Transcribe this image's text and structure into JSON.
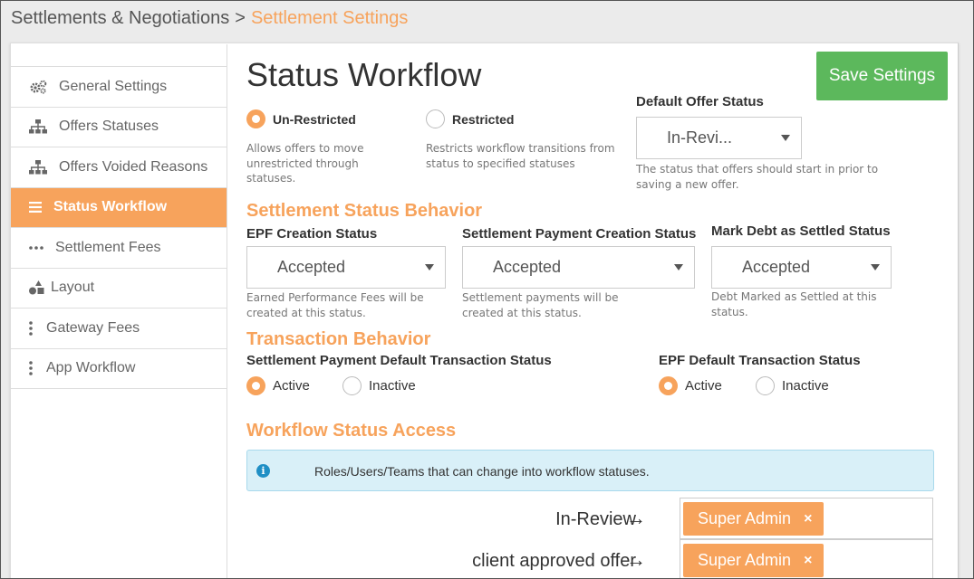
{
  "breadcrumb": {
    "parent": "Settlements & Negotiations",
    "separator": ">",
    "current": "Settlement Settings"
  },
  "sidebar": {
    "items": [
      {
        "label": "General Settings",
        "icon": "gears-icon",
        "active": false
      },
      {
        "label": "Offers Statuses",
        "icon": "sitemap-icon",
        "active": false
      },
      {
        "label": "Offers Voided Reasons",
        "icon": "sitemap-icon",
        "active": false
      },
      {
        "label": "Status Workflow",
        "icon": "list-icon",
        "active": true
      },
      {
        "label": "Settlement Fees",
        "icon": "ellipsis-h-icon",
        "active": false
      },
      {
        "label": "Layout",
        "icon": "shapes-icon",
        "active": false
      },
      {
        "label": "Gateway Fees",
        "icon": "ellipsis-v-icon",
        "active": false
      },
      {
        "label": "App Workflow",
        "icon": "ellipsis-v-icon",
        "active": false
      }
    ]
  },
  "main": {
    "title": "Status Workflow",
    "save_label": "Save Settings",
    "mode": {
      "unrestricted": {
        "label": "Un-Restricted",
        "help": "Allows offers to move unrestricted through statuses.",
        "selected": true
      },
      "restricted": {
        "label": "Restricted",
        "help": "Restricts workflow transitions from status to specified statuses",
        "selected": false
      }
    },
    "default_offer": {
      "label": "Default Offer Status",
      "value": "In-Revi...",
      "help": "The status that offers should start in prior to saving a new offer."
    },
    "settlement_behavior": {
      "title": "Settlement Status Behavior",
      "epf": {
        "label": "EPF Creation Status",
        "value": "Accepted",
        "help": "Earned Performance Fees will be created at this status."
      },
      "payment": {
        "label": "Settlement Payment Creation Status",
        "value": "Accepted",
        "help": "Settlement payments will be created at this status."
      },
      "debt": {
        "label": "Mark Debt as Settled Status",
        "value": "Accepted",
        "help": "Debt Marked as Settled at this status."
      }
    },
    "transaction_behavior": {
      "title": "Transaction Behavior",
      "payment_default": {
        "label": "Settlement Payment Default Transaction Status",
        "active": "Active",
        "inactive": "Inactive",
        "selected": "Active"
      },
      "epf_default": {
        "label": "EPF Default Transaction Status",
        "active": "Active",
        "inactive": "Inactive",
        "selected": "Active"
      }
    },
    "workflow_access": {
      "title": "Workflow Status Access",
      "info": "Roles/Users/Teams that can change into workflow statuses.",
      "arrow": "→",
      "rows": [
        {
          "status": "In-Review",
          "tags": [
            {
              "label": "Super Admin",
              "remove": "×"
            }
          ]
        },
        {
          "status": "client approved offer",
          "tags": [
            {
              "label": "Super Admin",
              "remove": "×"
            }
          ]
        }
      ]
    }
  },
  "colors": {
    "accent": "#f7a35c",
    "save": "#5cb85c",
    "info_bg": "#d9f0f8",
    "info_icon": "#1f8fc5"
  }
}
